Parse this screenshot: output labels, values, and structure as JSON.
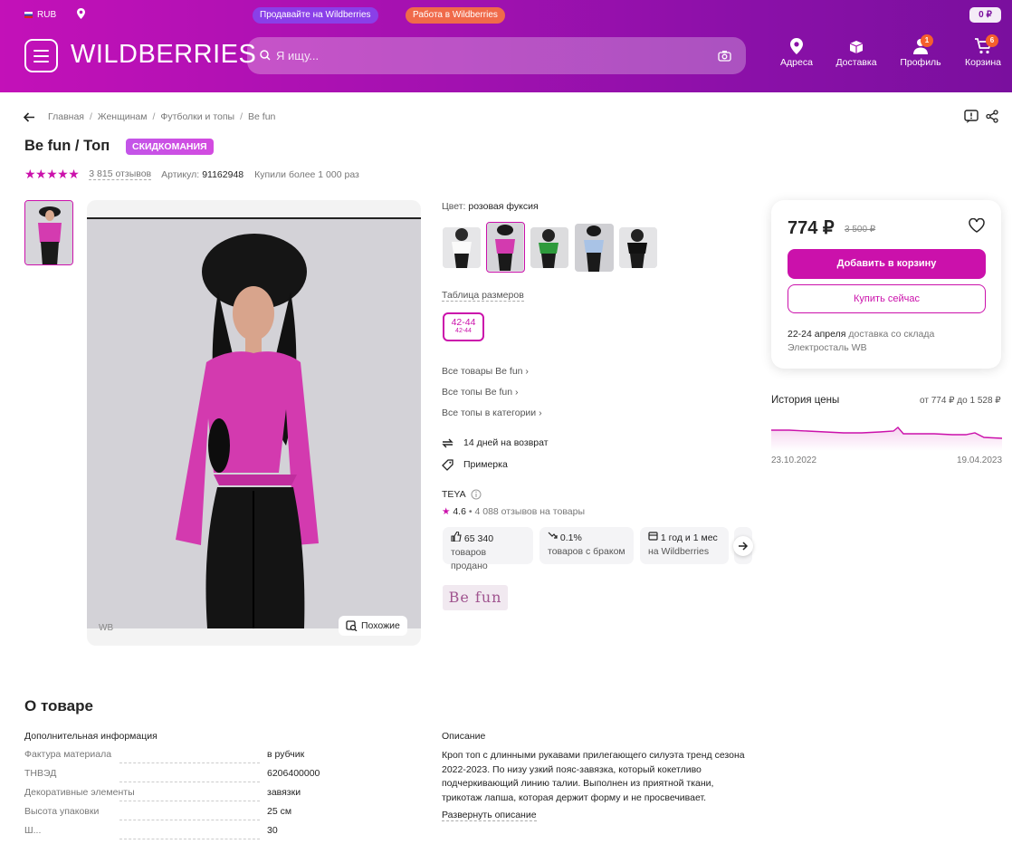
{
  "header": {
    "currency": "RUB",
    "sell_link": "Продавайте на Wildberries",
    "work_link": "Работа в Wildberries",
    "balance": "0 ₽",
    "logo": "WILDBERRIES",
    "search_placeholder": "Я ищу...",
    "nav": [
      {
        "label": "Адреса",
        "icon": "location-pin-icon"
      },
      {
        "label": "Доставка",
        "icon": "delivery-box-icon"
      },
      {
        "label": "Профиль",
        "icon": "profile-icon",
        "badge": "1"
      },
      {
        "label": "Корзина",
        "icon": "cart-icon",
        "badge": "6"
      }
    ],
    "colors": {
      "gradient_start": "#c311b8",
      "gradient_end": "#7a0f9e",
      "sell_pill": "#8a3fe8",
      "work_pill": "#f06a4a"
    }
  },
  "breadcrumbs": [
    "Главная",
    "Женщинам",
    "Футболки и топы",
    "Be fun"
  ],
  "product": {
    "title": "Be fun / Топ",
    "promo_badge": "СКИДКОМАНИЯ",
    "stars": "★★★★★",
    "reviews": "3 815 отзывов",
    "article_label": "Артикул:",
    "article": "91162948",
    "bought": "Купили более 1 000 раз",
    "gallery_watermark": "WB",
    "similar_button": "Похожие",
    "color_label": "Цвет:",
    "color_value": "розовая фуксия",
    "swatches": [
      "white",
      "pink",
      "green",
      "light-blue",
      "black"
    ],
    "size_table_link": "Таблица размеров",
    "size": {
      "main": "42-44",
      "sub": "42-44"
    },
    "links": [
      "Все товары Be fun",
      "Все топы Be fun",
      "Все топы в категории"
    ],
    "features": [
      {
        "icon": "return-arrows-icon",
        "text": "14 дней на возврат"
      },
      {
        "icon": "tag-icon",
        "text": "Примерка"
      }
    ],
    "seller": {
      "name": "TEYA",
      "rating": "4.6",
      "reviews": "4 088 отзывов на товары",
      "stats": [
        {
          "icon": "thumbs-up-icon",
          "value": "65 340",
          "label": "товаров продано"
        },
        {
          "icon": "trend-down-icon",
          "value": "0.1%",
          "label": "товаров с браком"
        },
        {
          "icon": "shop-icon",
          "value": "1 год и 1 мес",
          "label": "на Wildberries"
        }
      ],
      "brand_logo": "Be fun"
    },
    "accent": "#cb11ab"
  },
  "buy_box": {
    "price": "774 ₽",
    "old_price": "3 500 ₽",
    "add_to_cart": "Добавить в корзину",
    "buy_now": "Купить сейчас",
    "delivery_date": "22-24 апреля",
    "delivery_text": "доставка со склада",
    "warehouse": "Электросталь WB"
  },
  "price_history": {
    "title": "История цены",
    "range": "от 774 ₽ до 1 528 ₽",
    "date_start": "23.10.2022",
    "date_end": "19.04.2023"
  },
  "about": {
    "title": "О товаре",
    "params_title": "Дополнительная информация",
    "params": [
      {
        "k": "Фактура материала",
        "v": "в рубчик"
      },
      {
        "k": "ТНВЭД",
        "v": "6206400000"
      },
      {
        "k": "Декоративные элементы",
        "v": "завязки"
      },
      {
        "k": "Высота упаковки",
        "v": "25 см"
      },
      {
        "k": "Ш...",
        "v": "30"
      }
    ],
    "desc_title": "Описание",
    "description": "Кроп топ с длинными рукавами прилегающего силуэта тренд сезона 2022-2023. По низу узкий пояс-завязка, который кокетливо подчеркивающий линию талии. Выполнен из приятной ткани, трикотаж лапша, которая держит форму и не просвечивает.",
    "expand": "Развернуть описание"
  }
}
